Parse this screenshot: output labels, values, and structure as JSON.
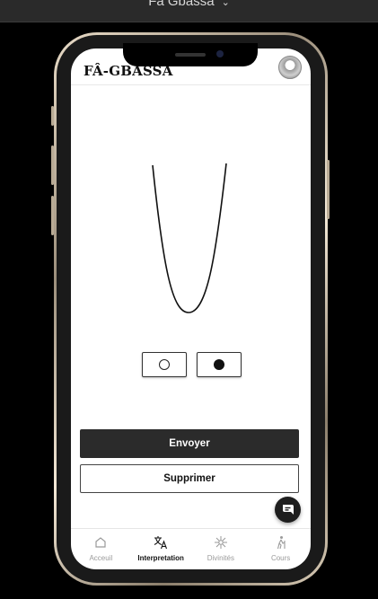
{
  "window": {
    "title": "Fa Gbassa"
  },
  "app": {
    "title": "FÂ-GBASSA"
  },
  "marks": [
    {
      "name": "open-circle-mark",
      "symbol": "○"
    },
    {
      "name": "filled-circle-mark",
      "symbol": "●"
    }
  ],
  "actions": {
    "send_label": "Envoyer",
    "delete_label": "Supprimer"
  },
  "nav": {
    "items": [
      {
        "label": "Acceuil",
        "icon": "home-icon",
        "active": false
      },
      {
        "label": "Interpretation",
        "icon": "translate-icon",
        "active": true
      },
      {
        "label": "Divinités",
        "icon": "divinity-icon",
        "active": false
      },
      {
        "label": "Cours",
        "icon": "hiking-icon",
        "active": false
      }
    ]
  },
  "colors": {
    "accent": "#2b2b2b",
    "background": "#000000",
    "screen": "#ffffff"
  }
}
